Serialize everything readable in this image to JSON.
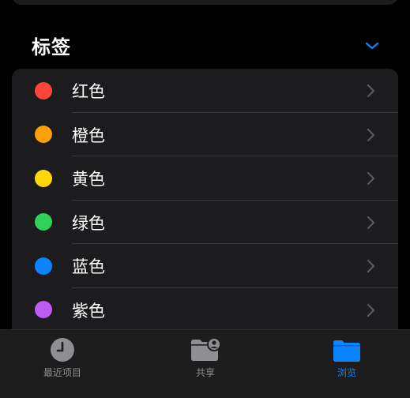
{
  "section": {
    "title": "标签"
  },
  "tags": [
    {
      "label": "红色",
      "color": "#ff453a"
    },
    {
      "label": "橙色",
      "color": "#ff9f0a"
    },
    {
      "label": "黄色",
      "color": "#ffd60a"
    },
    {
      "label": "绿色",
      "color": "#30d158"
    },
    {
      "label": "蓝色",
      "color": "#0a84ff"
    },
    {
      "label": "紫色",
      "color": "#bf5af2"
    }
  ],
  "tabbar": {
    "recents_label": "最近项目",
    "shared_label": "共享",
    "browse_label": "浏览",
    "active_tab": "browse"
  },
  "colors": {
    "accent": "#0a84ff",
    "inactive": "#8e8e93",
    "card_bg": "#1c1c1e"
  },
  "icons": {
    "collapse": "chevron-down-icon",
    "row": "chevron-right-icon",
    "recents": "clock-icon",
    "shared": "shared-folder-icon",
    "browse": "folder-icon"
  }
}
